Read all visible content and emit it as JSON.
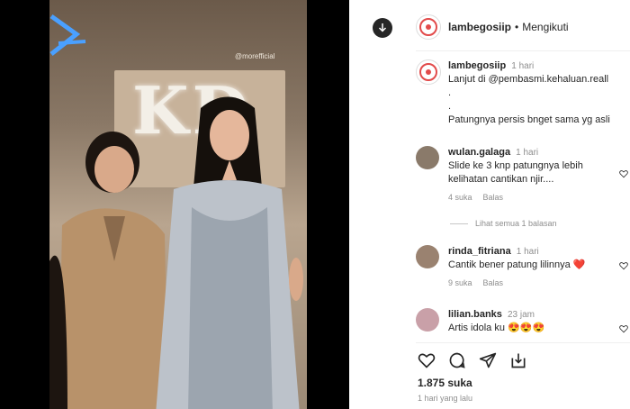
{
  "post": {
    "watermark": "@morefficial",
    "sign_text": "KD"
  },
  "header": {
    "username": "lambegosiip",
    "separator": "•",
    "follow_label": "Mengikuti"
  },
  "caption": {
    "username": "lambegosiip",
    "time": "1 hari",
    "line1": "Lanjut di @pembasmi.kehaluan.reall",
    "line2": ".",
    "line3": ".",
    "line4": "Patungnya persis bnget sama yg asli"
  },
  "comments": [
    {
      "username": "wulan.galaga",
      "time": "1 hari",
      "text": "Slide ke 3 knp patungnya lebih kelihatan cantikan njir....",
      "likes": "4 suka",
      "reply_label": "Balas",
      "avatar_color": "#8a7a6a"
    },
    {
      "username": "rinda_fitriana",
      "time": "1 hari",
      "text": "Cantik bener patung lilinnya",
      "emoji": "❤️",
      "likes": "9 suka",
      "reply_label": "Balas",
      "avatar_color": "#9a8270"
    },
    {
      "username": "lilian.banks",
      "time": "23 jam",
      "text": "Artis idola ku",
      "emoji": "😍😍😍",
      "avatar_color": "#c9a0a8"
    }
  ],
  "view_replies": "Lihat semua 1 balasan",
  "likes_count": "1.875 suka",
  "posted_date": "1 hari yang lalu"
}
